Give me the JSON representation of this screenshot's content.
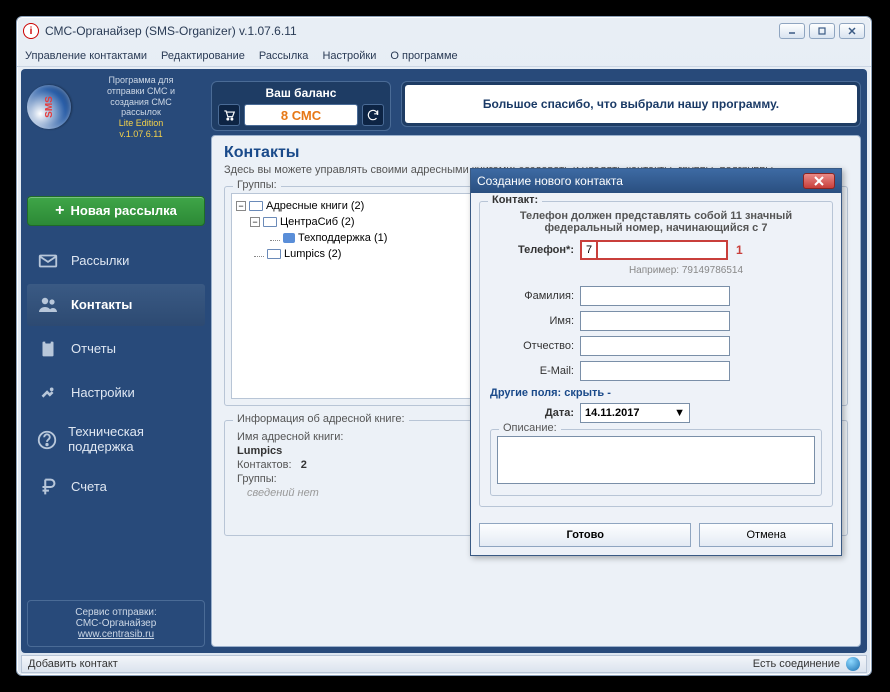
{
  "window": {
    "title": "СМС-Органайзер (SMS-Organizer) v.1.07.6.11"
  },
  "menu": {
    "contacts": "Управление контактами",
    "edit": "Редактирование",
    "send": "Рассылка",
    "settings": "Настройки",
    "about": "О программе"
  },
  "brand": {
    "tag1": "Программа для",
    "tag2": "отправки СМС и",
    "tag3": "создания СМС",
    "tag4": "рассылок",
    "lite": "Lite Edition",
    "ver": "v.1.07.6.11",
    "logo": "SMS"
  },
  "balance": {
    "title": "Ваш баланс",
    "value": "8 СМС"
  },
  "thanks": "Большое спасибо, что выбрали нашу программу.",
  "nav": {
    "new": "Новая рассылка",
    "items": [
      {
        "label": "Рассылки"
      },
      {
        "label": "Контакты"
      },
      {
        "label": "Отчеты"
      },
      {
        "label": "Настройки"
      },
      {
        "label": "Техническая поддержка"
      },
      {
        "label": "Счета"
      }
    ]
  },
  "service": {
    "l1": "Сервис отправки:",
    "l2": "СМС-Органайзер",
    "url": "www.centrasib.ru"
  },
  "main": {
    "title": "Контакты",
    "desc": "Здесь вы можете управлять своими адресными книгами: создавать и удалять контакты, группы, подгруппы.",
    "groups_label": "Группы:",
    "tree": {
      "root": "Адресные книги (2)",
      "n1": "ЦентраСиб (2)",
      "n2": "Техподдержка (1)",
      "n3": "Lumpics (2)"
    },
    "info": {
      "legend": "Информация об адресной книге:",
      "name_lbl": "Имя адресной книги:",
      "name_val": "Lumpics",
      "cnt_lbl": "Контактов:",
      "cnt_val": "2",
      "grp_lbl": "Группы:",
      "grp_val": "сведений нет"
    }
  },
  "dialog": {
    "title": "Создание нового контакта",
    "contact_legend": "Контакт:",
    "hint": "Телефон должен представлять собой 11 значный федеральный номер, начинающийся с 7",
    "phone_lbl": "Телефон*:",
    "phone_prefix": "7",
    "phone_val": "",
    "phone_count": "1",
    "example": "Например: 79149786514",
    "lname": "Фамилия:",
    "fname": "Имя:",
    "mname": "Отчество:",
    "email": "E-Mail:",
    "other": "Другие поля: скрыть -",
    "date_lbl": "Дата:",
    "date_val": "14.11.2017",
    "desc_legend": "Описание:",
    "ok": "Готово",
    "cancel": "Отмена"
  },
  "status": {
    "left": "Добавить контакт",
    "right": "Есть соединение"
  }
}
